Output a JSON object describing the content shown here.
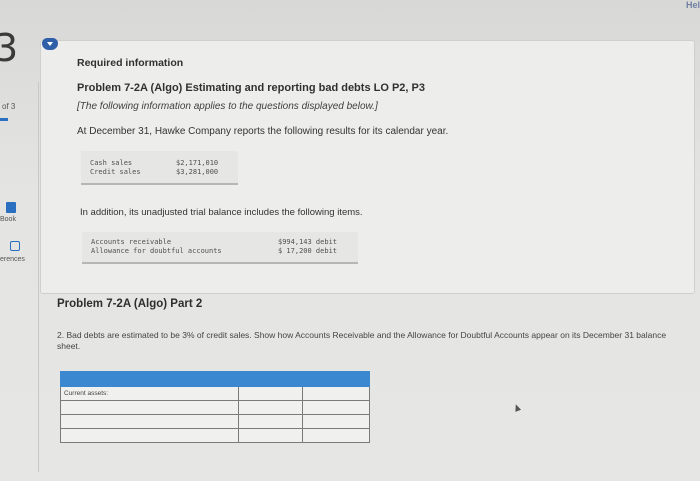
{
  "header": {
    "help_label": "Hel"
  },
  "navigation": {
    "question_number": "3",
    "question_of": "of 3",
    "ebook_label": "Book",
    "references_label": "erences"
  },
  "required_info": {
    "heading": "Required information",
    "problem_title": "Problem 7-2A (Algo) Estimating and reporting bad debts LO P2, P3",
    "note": "[The following information applies to the questions displayed below.]",
    "intro": "At December 31, Hawke Company reports the following results for its calendar year.",
    "sales": [
      {
        "label": "Cash sales",
        "amount": "$2,171,010"
      },
      {
        "label": "Credit sales",
        "amount": "$3,281,000"
      }
    ],
    "intro2": "In addition, its unadjusted trial balance includes the following items.",
    "trial_balance": [
      {
        "label": "Accounts receivable",
        "amount": "$994,143 debit"
      },
      {
        "label": "Allowance for doubtful accounts",
        "amount": "$ 17,200 debit"
      }
    ]
  },
  "part": {
    "title": "Problem 7-2A (Algo) Part 2",
    "question": "2. Bad debts are estimated to be 3% of credit sales. Show how Accounts Receivable and the Allowance for Doubtful Accounts appear on its December 31 balance sheet."
  },
  "answer_table": {
    "first_row_label": "Current assets:",
    "colors": {
      "header": "#3b88d0"
    }
  },
  "colors": {
    "accent": "#2f5fa8",
    "help": "#6f7fa2"
  }
}
